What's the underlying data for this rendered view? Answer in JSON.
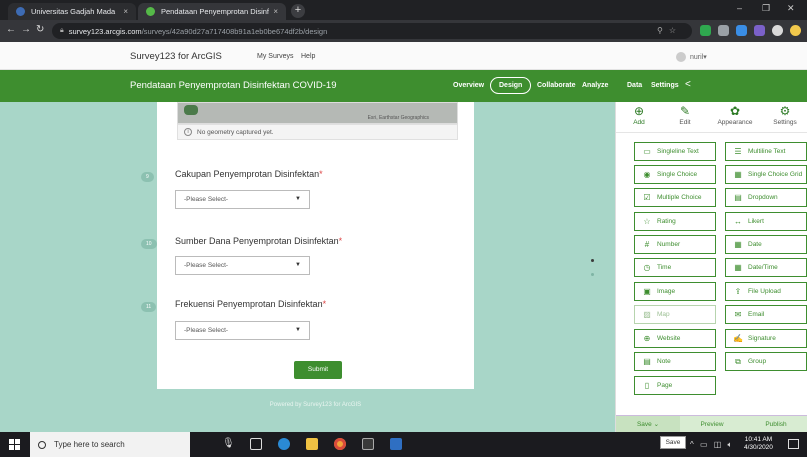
{
  "browser": {
    "tabs": [
      {
        "title": "Universitas Gadjah Mada",
        "close": "×"
      },
      {
        "title": "Pendataan Penyemprotan Disinfe",
        "close": "×"
      }
    ],
    "new_tab": "+",
    "window_controls": [
      "–",
      "❐",
      "✕"
    ],
    "url_host": "survey123.arcgis.com",
    "url_path": "/surveys/42a90d27a717408b91a1eb0be674df2b/design"
  },
  "app_header": {
    "brand": "Survey123 for ArcGIS",
    "my_surveys": "My Surveys",
    "help": "Help",
    "user": "nuril"
  },
  "survey_nav": {
    "title": "Pendataan Penyemprotan Disinfektan COVID-19",
    "items": [
      "Overview",
      "Design",
      "Collaborate",
      "Analyze",
      "Data",
      "Settings"
    ],
    "active": "Design"
  },
  "form": {
    "map_attribution": "Esri, Earthstar Geographics",
    "geometry_note": "No geometry captured yet.",
    "questions": [
      {
        "num": "9",
        "label": "Cakupan Penyemprotan Disinfektan",
        "req": "*",
        "placeholder": "-Please Select-"
      },
      {
        "num": "10",
        "label": "Sumber Dana Penyemprotan Disinfektan",
        "req": "*",
        "placeholder": "-Please Select-"
      },
      {
        "num": "11",
        "label": "Frekuensi Penyemprotan Disinfektan",
        "req": "*",
        "placeholder": "-Please Select-"
      }
    ],
    "submit": "Submit",
    "powered_by": "Powered by Survey123 for ArcGIS"
  },
  "panel": {
    "tabs": [
      "Add",
      "Edit",
      "Appearance",
      "Settings"
    ],
    "active_tab": "Add",
    "buttons": [
      "Singleline Text",
      "Multiline Text",
      "Single Choice",
      "Single Choice Grid",
      "Multiple Choice",
      "Dropdown",
      "Rating",
      "Likert",
      "Number",
      "Date",
      "Time",
      "Date/Time",
      "Image",
      "File Upload",
      "Map",
      "Email",
      "Website",
      "Signature",
      "Note",
      "Group",
      "Page"
    ],
    "bottom": [
      "Save",
      "Preview",
      "Publish"
    ]
  },
  "taskbar": {
    "search_placeholder": "Type here to search",
    "tooltip": "Save",
    "time": "10:41 AM",
    "date": "4/30/2020"
  },
  "colors": {
    "brand_green": "#3e8e2f",
    "canvas_teal": "#a8d6c8"
  }
}
